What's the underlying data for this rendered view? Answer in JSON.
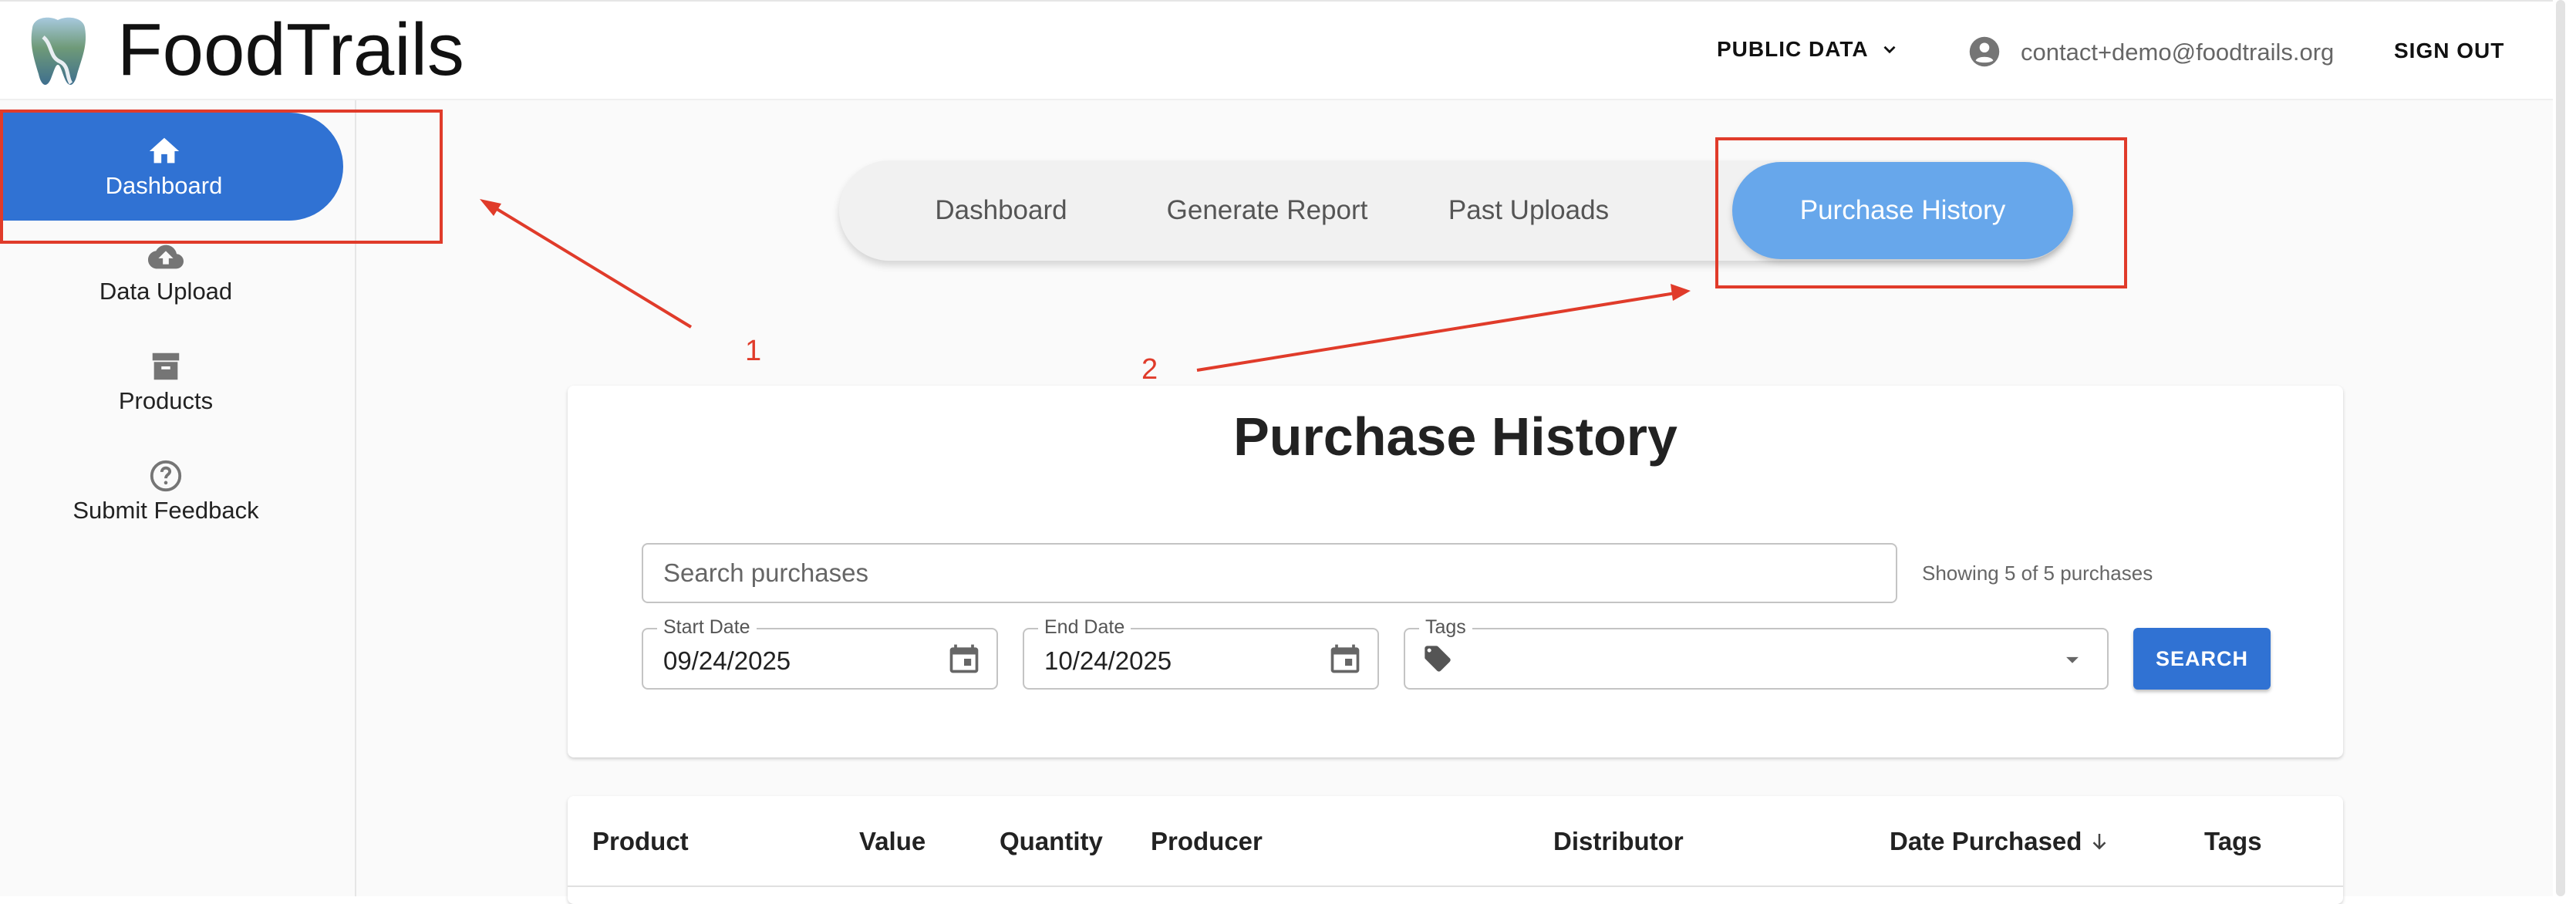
{
  "header": {
    "brand": "FoodTrails",
    "public_data_label": "PUBLIC DATA",
    "email": "contact+demo@foodtrails.org",
    "sign_out_label": "SIGN OUT"
  },
  "sidebar": {
    "items": [
      {
        "label": "Dashboard",
        "icon": "home-icon",
        "active": true
      },
      {
        "label": "Data Upload",
        "icon": "cloud-upload-icon",
        "active": false
      },
      {
        "label": "Products",
        "icon": "archive-icon",
        "active": false
      },
      {
        "label": "Submit Feedback",
        "icon": "help-circle-icon",
        "active": false
      }
    ]
  },
  "tabs": [
    {
      "label": "Dashboard",
      "active": false
    },
    {
      "label": "Generate Report",
      "active": false
    },
    {
      "label": "Past Uploads",
      "active": false
    },
    {
      "label": "Purchase History",
      "active": true
    }
  ],
  "annotations": {
    "one": "1",
    "two": "2",
    "color": "#e03b2a"
  },
  "purchase_history": {
    "title": "Purchase History",
    "search_placeholder": "Search purchases",
    "count_text": "Showing 5 of 5 purchases",
    "start_date_label": "Start Date",
    "start_date_value": "09/24/2025",
    "end_date_label": "End Date",
    "end_date_value": "10/24/2025",
    "tags_label": "Tags",
    "search_button": "SEARCH"
  },
  "table": {
    "columns": [
      "Product",
      "Value",
      "Quantity",
      "Producer",
      "Distributor",
      "Date Purchased",
      "Tags"
    ],
    "sorted_column": "Date Purchased",
    "sort_direction": "desc"
  },
  "colors": {
    "primary": "#3072d3",
    "active_tab": "#67a7eb",
    "annotation": "#e03b2a"
  }
}
